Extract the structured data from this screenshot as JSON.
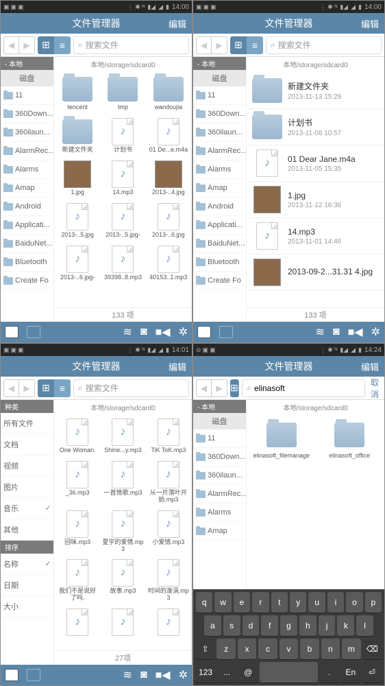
{
  "status": {
    "time1": "14:00",
    "time2": "14:00",
    "time3": "14:01",
    "time4": "14:24"
  },
  "title": "文件管理器",
  "edit": "编辑",
  "search_ph": "搜索文件",
  "cancel": "取消",
  "search_val": "elinasoft",
  "path": "本地/storage/sdcard0",
  "side": {
    "hdr": "-   本地",
    "disk": "磁盘",
    "cat": "种类"
  },
  "disk_items": [
    "11",
    "360Down...",
    "360ilaun...",
    "AlarmRec...",
    "Alarms",
    "Amap",
    "Android",
    "Applicati...",
    "BaiduNet...",
    "Bluetooth",
    "Create Fo"
  ],
  "disk_items2": [
    "11",
    "360Down...",
    "360ilaun...",
    "AlarmRec...",
    "Alarms",
    "Amap"
  ],
  "cat_items": [
    "所有文件",
    "文档",
    "视频",
    "图片",
    "音乐",
    "其他"
  ],
  "sort_hdr": "排序",
  "sort_items": [
    "名称",
    "日期",
    "大小"
  ],
  "s1_grid": [
    {
      "t": "folder",
      "n": "tencent"
    },
    {
      "t": "folder",
      "n": "tmp"
    },
    {
      "t": "folder",
      "n": "wandoujia"
    },
    {
      "t": "folder",
      "n": "新建文件夹"
    },
    {
      "t": "file",
      "i": "♪",
      "n": "计划书"
    },
    {
      "t": "file",
      "i": "♪",
      "n": "01 De...e.m4a"
    },
    {
      "t": "img",
      "n": "1.jpg"
    },
    {
      "t": "file",
      "i": "♪",
      "n": "14.mp3"
    },
    {
      "t": "img",
      "n": "2013-..4.jpg"
    },
    {
      "t": "file",
      "i": "♪",
      "n": "2013-..5.jpg"
    },
    {
      "t": "file",
      "i": "♪",
      "n": "2013-..5.jpg-"
    },
    {
      "t": "file",
      "i": "♪",
      "n": "2013-..6.jpg"
    },
    {
      "t": "file",
      "i": "♪",
      "n": "2013-..6.jpg-"
    },
    {
      "t": "file",
      "i": "♪",
      "n": "39398..8.mp3"
    },
    {
      "t": "file",
      "i": "♪",
      "n": "40153..1.mp3"
    }
  ],
  "s1_footer": "133 项",
  "s2_list": [
    {
      "t": "folder",
      "n": "新建文件夹",
      "d": "2013-11-13 15:29"
    },
    {
      "t": "folder",
      "n": "计划书",
      "d": "2013-11-06 10:57"
    },
    {
      "t": "file",
      "i": "♪",
      "n": "01 Dear Jane.m4a",
      "d": "2013-11-05 15:35"
    },
    {
      "t": "img",
      "n": "1.jpg",
      "d": "2013-11-12 16:36"
    },
    {
      "t": "file",
      "i": "♪",
      "n": "14.mp3",
      "d": "2013-11-01 14:46"
    },
    {
      "t": "img",
      "n": "2013-09-2...31.31 4.jpg",
      "d": ""
    }
  ],
  "s2_footer": "133 项",
  "s3_grid": [
    {
      "t": "file",
      "i": "♪",
      "n": "One Woman."
    },
    {
      "t": "file",
      "i": "♪",
      "n": "Shine...y.mp3"
    },
    {
      "t": "file",
      "i": "♪",
      "n": "TiK ToK.mp3"
    },
    {
      "t": "file",
      "i": "♪",
      "n": "_36.mp3"
    },
    {
      "t": "file",
      "i": "♪",
      "n": "一首情歌.mp3"
    },
    {
      "t": "file",
      "i": "♪",
      "n": "从一片落叶开始.mp3"
    },
    {
      "t": "file",
      "i": "♪",
      "n": "回味.mp3"
    },
    {
      "t": "file",
      "i": "♪",
      "n": "夏宇的爱情.mp3"
    },
    {
      "t": "file",
      "i": "♪",
      "n": "小爱情.mp3"
    },
    {
      "t": "file",
      "i": "♪",
      "n": "我们不是说好了吗."
    },
    {
      "t": "file",
      "i": "♪",
      "n": "故事.mp3"
    },
    {
      "t": "file",
      "i": "♪",
      "n": "时间的漩涡.mp3"
    },
    {
      "t": "file",
      "i": "♪",
      "n": ""
    },
    {
      "t": "file",
      "i": "♪",
      "n": ""
    },
    {
      "t": "file",
      "i": "♪",
      "n": ""
    }
  ],
  "s3_footer": "27项",
  "s4_grid": [
    {
      "t": "folder",
      "n": "elinasoft_filemanage"
    },
    {
      "t": "folder",
      "n": "elinasoft_office"
    }
  ],
  "kb": {
    "r1": [
      "q",
      "w",
      "e",
      "r",
      "t",
      "y",
      "u",
      "i",
      "o",
      "p"
    ],
    "r2": [
      "a",
      "s",
      "d",
      "f",
      "g",
      "h",
      "j",
      "k",
      "l"
    ],
    "r3": [
      "⇧",
      "z",
      "x",
      "c",
      "v",
      "b",
      "n",
      "m",
      "⌫"
    ],
    "r4": [
      "123",
      "...",
      "@",
      " ",
      ".",
      "En",
      "⏎"
    ]
  }
}
